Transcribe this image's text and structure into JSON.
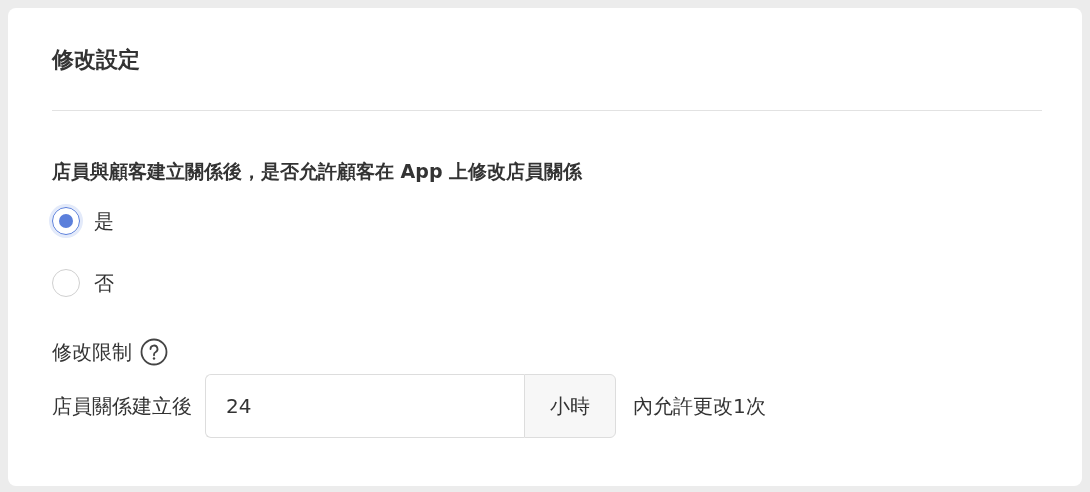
{
  "title": "修改設定",
  "question": "店員與顧客建立關係後，是否允許顧客在 App 上修改店員關係",
  "options": [
    {
      "label": "是",
      "selected": true
    },
    {
      "label": "否",
      "selected": false
    }
  ],
  "limit": {
    "label": "修改限制",
    "prefix": "店員關係建立後",
    "value": "24",
    "unit": "小時",
    "suffix": "內允許更改1次"
  }
}
